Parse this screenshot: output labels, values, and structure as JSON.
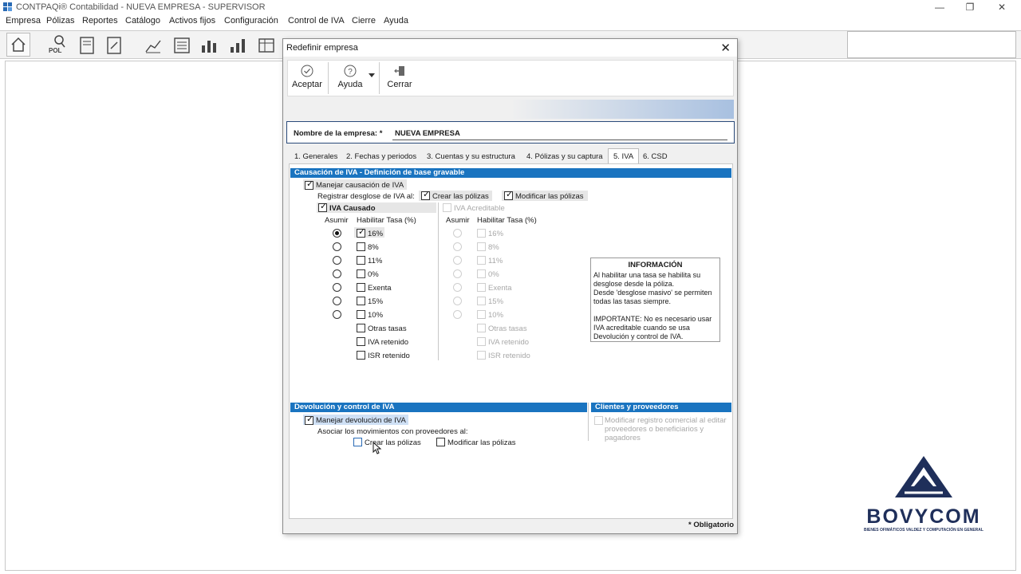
{
  "window": {
    "title": "CONTPAQi® Contabilidad - NUEVA EMPRESA - SUPERVISOR",
    "min_icon": "minimize-icon",
    "max_icon": "restore-icon",
    "close_icon": "close-icon"
  },
  "menu": [
    "Empresa",
    "Pólizas",
    "Reportes",
    "Catálogo",
    "Activos fijos",
    "Configuración",
    "Control de IVA",
    "Cierre",
    "Ayuda"
  ],
  "toolbar": {
    "pol_label": "POL"
  },
  "dialog": {
    "title": "Redefinir empresa",
    "buttons": {
      "accept": "Aceptar",
      "help": "Ayuda",
      "close": "Cerrar"
    },
    "company_label": "Nombre de la empresa: *",
    "company_value": "NUEVA EMPRESA",
    "tabs": [
      "1. Generales",
      "2. Fechas y periodos",
      "3. Cuentas y su estructura",
      "4. Pólizas y su captura",
      "5. IVA",
      "6. CSD"
    ],
    "active_tab": "5. IVA",
    "required_note": "* Obligatorio"
  },
  "iva": {
    "section1_title": "Causación de IVA - Definición de base gravable",
    "manage_causation": "Manejar causación de IVA",
    "register_breakdown": "Registrar desglose de IVA al:",
    "create_policies": "Crear las pólizas",
    "modify_policies": "Modificar las pólizas",
    "causado": {
      "label": "IVA Causado",
      "col_assume": "Asumir",
      "col_enable": "Habilitar Tasa (%)",
      "rates": [
        "16%",
        "8%",
        "11%",
        "0%",
        "Exenta",
        "15%",
        "10%"
      ],
      "extras": [
        "Otras tasas",
        "IVA retenido",
        "ISR retenido"
      ],
      "checked_rate": "16%",
      "assumed_rate": "16%"
    },
    "acreditable": {
      "label": "IVA Acreditable",
      "col_assume": "Asumir",
      "col_enable": "Habilitar Tasa (%)",
      "rates": [
        "16%",
        "8%",
        "11%",
        "0%",
        "Exenta",
        "15%",
        "10%"
      ],
      "extras": [
        "Otras tasas",
        "IVA retenido",
        "ISR retenido"
      ]
    },
    "info": {
      "title": "INFORMACIÓN",
      "line1": "Al habilitar una tasa se habilita su desglose desde la póliza.",
      "line2": "Desde 'desglose masivo' se permiten todas las tasas siempre.",
      "line3": "IMPORTANTE: No es necesario usar IVA acreditable cuando se usa Devolución y control de IVA."
    },
    "section2_title": "Devolución y control de IVA",
    "manage_refund": "Manejar devolución de IVA",
    "associate_moves": "Asociar los movimientos con proveedores al:",
    "refund_create": "Crear las pólizas",
    "refund_modify": "Modificar las pólizas",
    "section3_title": "Clientes y proveedores",
    "commercial_register": "Modificar registro comercial al editar proveedores o beneficiarios y pagadores"
  },
  "logo": {
    "brand": "BOVYCOM",
    "tagline": "BIENES OFIMÁTICOS VALDEZ Y COMPUTACIÓN EN GENERAL",
    "color": "#1f2f5a"
  }
}
